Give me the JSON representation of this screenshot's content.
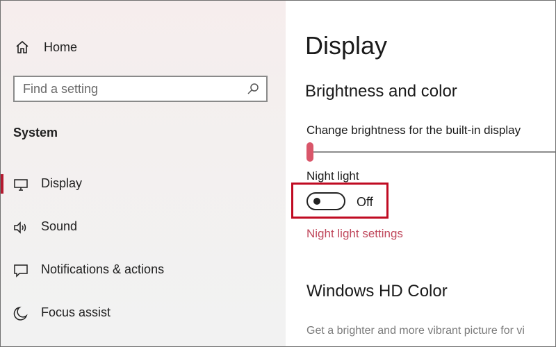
{
  "sidebar": {
    "home_label": "Home",
    "search_placeholder": "Find a setting",
    "section_title": "System",
    "items": [
      {
        "label": "Display",
        "icon": "monitor-icon",
        "selected": true
      },
      {
        "label": "Sound",
        "icon": "speaker-icon",
        "selected": false
      },
      {
        "label": "Notifications & actions",
        "icon": "notification-icon",
        "selected": false
      },
      {
        "label": "Focus assist",
        "icon": "moon-icon",
        "selected": false
      }
    ]
  },
  "main": {
    "page_title": "Display",
    "brightness_section_title": "Brightness and color",
    "brightness_label": "Change brightness for the built-in display",
    "brightness_value": 0,
    "night_light_label": "Night light",
    "night_light_state": "Off",
    "night_light_settings_link": "Night light settings",
    "hd_section_title": "Windows HD Color",
    "hd_description": "Get a brighter and more vibrant picture for vi"
  },
  "colors": {
    "accent": "#b41a30",
    "slider": "#d9566a",
    "link": "#c0485c",
    "highlight_border": "#c00b22"
  }
}
